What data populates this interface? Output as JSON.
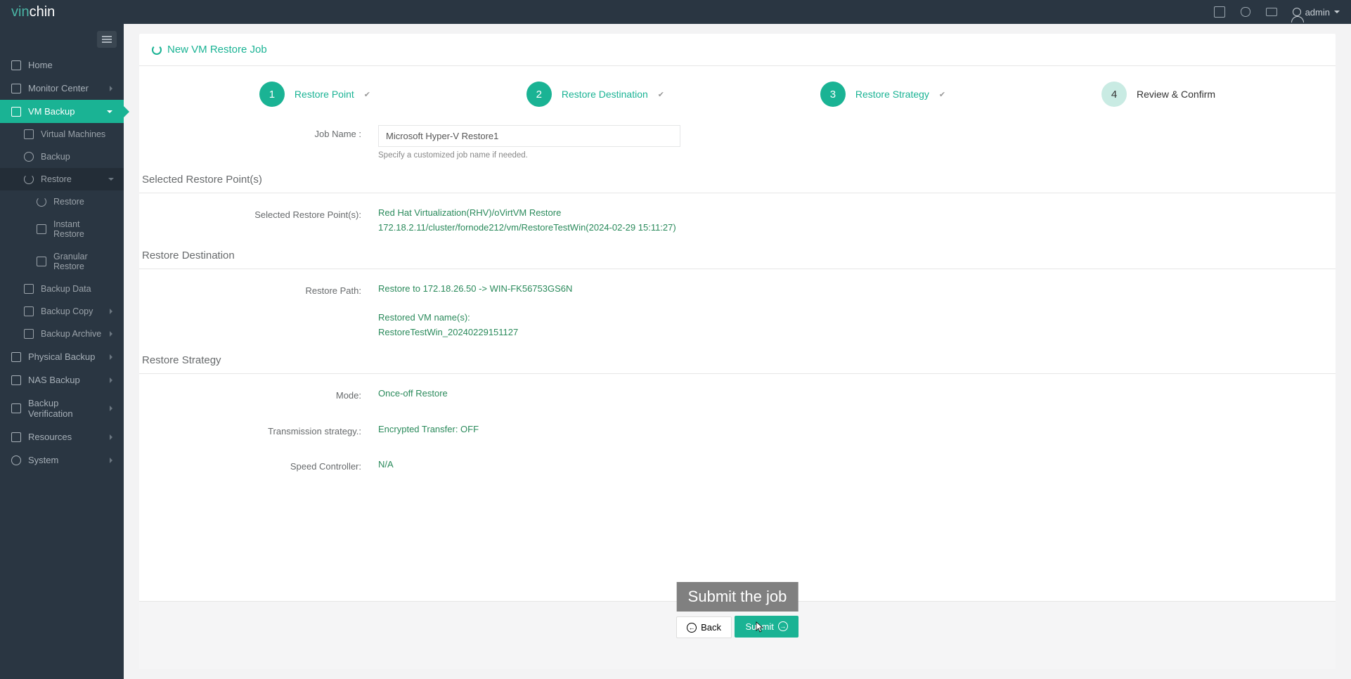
{
  "brand": {
    "part1": "vin",
    "part2": "chin"
  },
  "user": {
    "name": "admin"
  },
  "nav": {
    "home": "Home",
    "monitorCenter": "Monitor Center",
    "vmBackup": "VM Backup",
    "virtualMachines": "Virtual Machines",
    "backup": "Backup",
    "restore": "Restore",
    "restoreSub": "Restore",
    "instantRestore": "Instant Restore",
    "granularRestore": "Granular Restore",
    "backupData": "Backup Data",
    "backupCopy": "Backup Copy",
    "backupArchive": "Backup Archive",
    "physicalBackup": "Physical Backup",
    "nasBackup": "NAS Backup",
    "backupVerification": "Backup Verification",
    "resources": "Resources",
    "system": "System"
  },
  "page": {
    "title": "New VM Restore Job"
  },
  "wizard": {
    "step1": {
      "num": "1",
      "label": "Restore Point"
    },
    "step2": {
      "num": "2",
      "label": "Restore Destination"
    },
    "step3": {
      "num": "3",
      "label": "Restore Strategy"
    },
    "step4": {
      "num": "4",
      "label": "Review & Confirm"
    }
  },
  "form": {
    "jobNameLabel": "Job Name :",
    "jobNameValue": "Microsoft Hyper-V Restore1",
    "jobNameHelp": "Specify a customized job name if needed.",
    "sectionRestorePoints": "Selected Restore Point(s)",
    "selectedRestorePointsLabel": "Selected Restore Point(s):",
    "selectedRestorePointsLine1": "Red Hat Virtualization(RHV)/oVirtVM Restore",
    "selectedRestorePointsLine2": "172.18.2.11/cluster/fornode212/vm/RestoreTestWin(2024-02-29 15:11:27)",
    "sectionRestoreDest": "Restore Destination",
    "restorePathLabel": "Restore Path:",
    "restorePathValue": "Restore to 172.18.26.50 -> WIN-FK56753GS6N",
    "restoredVmLabel": "Restored VM name(s):",
    "restoredVmValue": "RestoreTestWin_20240229151127",
    "sectionStrategy": "Restore Strategy",
    "modeLabel": "Mode:",
    "modeValue": "Once-off Restore",
    "transmissionLabel": "Transmission strategy.:",
    "transmissionValue": "Encrypted Transfer: OFF",
    "speedLabel": "Speed Controller:",
    "speedValue": "N/A"
  },
  "tooltip": "Submit the job",
  "buttons": {
    "back": "Back",
    "submit": "Submit"
  }
}
